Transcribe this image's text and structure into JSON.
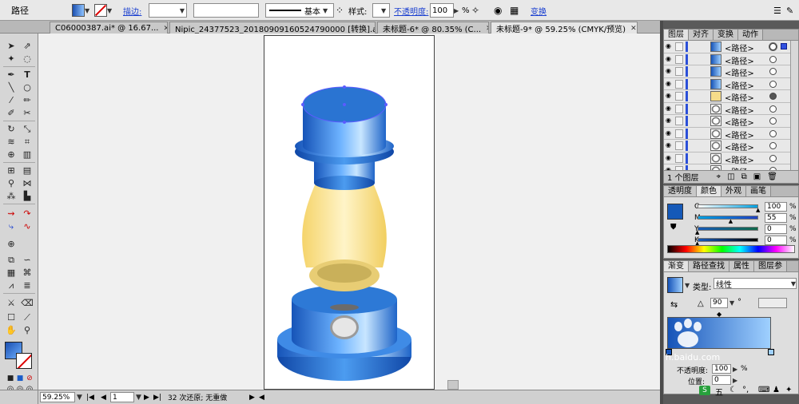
{
  "control_bar": {
    "selection_label": "路径",
    "stroke_label": "描边:",
    "brush_label": "基本",
    "style_label": "样式:",
    "opacity_label": "不透明度:",
    "opacity_value": "100",
    "opacity_unit": "%",
    "transform_label": "变换"
  },
  "tabs": [
    {
      "label": "C06000387.ai* @ 16.67..."
    },
    {
      "label": "Nipic_24377523_20180909160524790000 [转换].ai*..."
    },
    {
      "label": "未标题-6* @ 80.35% (C..."
    },
    {
      "label": "未标题-9* @ 59.25% (CMYK/预览)"
    }
  ],
  "status_bar": {
    "zoom": "59.25%",
    "page": "1",
    "undo_text": "32 次还原; 无重做"
  },
  "layers_panel": {
    "tabs": [
      "图层",
      "对齐",
      "变换",
      "动作"
    ],
    "rows": [
      {
        "name": "<路径>",
        "thumb": "blue-grad",
        "target": "special"
      },
      {
        "name": "<路径>",
        "thumb": "blue-grad",
        "target": "empty"
      },
      {
        "name": "<路径>",
        "thumb": "blue-grad",
        "target": "empty"
      },
      {
        "name": "<路径>",
        "thumb": "blue-grad",
        "target": "empty"
      },
      {
        "name": "<路径>",
        "thumb": "yellow",
        "target": "filled"
      },
      {
        "name": "<路径>",
        "thumb": "gray-oval",
        "target": "empty"
      },
      {
        "name": "<路径>",
        "thumb": "gray-oval",
        "target": "empty"
      },
      {
        "name": "<路径>",
        "thumb": "gray-oval",
        "target": "empty"
      },
      {
        "name": "<路径>",
        "thumb": "gray-oval",
        "target": "empty"
      },
      {
        "name": "<路径>",
        "thumb": "gray-oval",
        "target": "empty"
      },
      {
        "name": "<路径>",
        "thumb": "gray-oval",
        "target": "empty"
      }
    ],
    "footer": "1 个图层"
  },
  "color_panel": {
    "tabs": [
      "透明度",
      "颜色",
      "外观",
      "画笔"
    ],
    "channels": [
      {
        "label": "C",
        "value": "100",
        "unit": "%",
        "level": 1.0
      },
      {
        "label": "M",
        "value": "55",
        "unit": "%",
        "level": 0.55
      },
      {
        "label": "Y",
        "value": "0",
        "unit": "%",
        "level": 0
      },
      {
        "label": "K",
        "value": "0",
        "unit": "%",
        "level": 0
      }
    ],
    "fill_color": "#1559b8"
  },
  "gradient_panel": {
    "tabs": [
      "渐变",
      "路径查找",
      "属性",
      "图层参"
    ],
    "type_label": "类型:",
    "type_value": "线性",
    "angle": "90",
    "angle_unit": "°",
    "opacity_label": "不透明度:",
    "opacity_value": "100",
    "opacity_unit": "%",
    "location_label": "位置:",
    "location_value": "0",
    "watermark_domain": "h.baidu.com",
    "ime_label": "五"
  },
  "colors": {
    "accent_blue": "#1a5cc8",
    "lamp_yellow": "#f3d97a"
  }
}
